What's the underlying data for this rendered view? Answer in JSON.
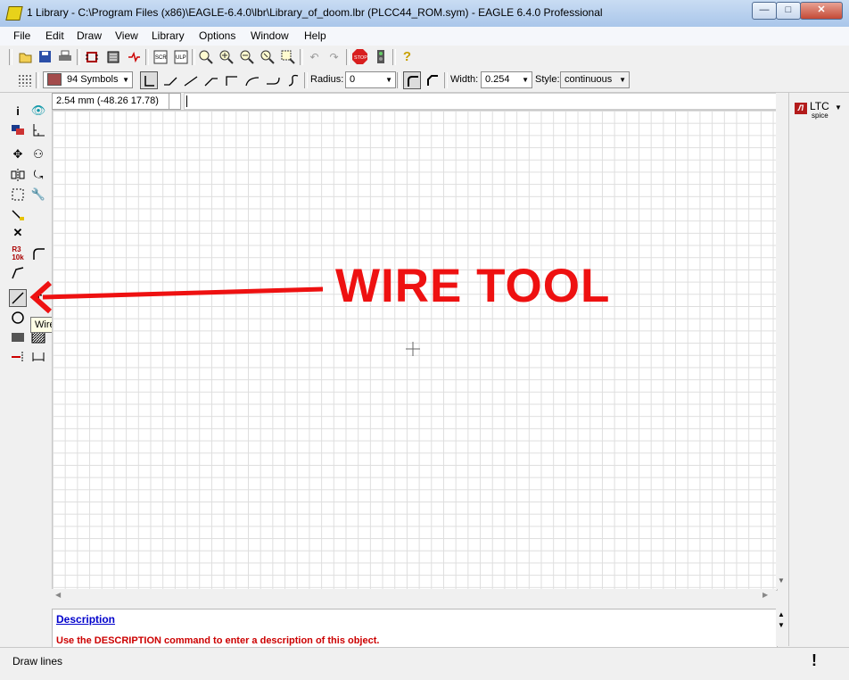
{
  "window": {
    "title": "1 Library - C:\\Program Files (x86)\\EAGLE-6.4.0\\lbr\\Library_of_doom.lbr (PLCC44_ROM.sym) - EAGLE 6.4.0 Professional",
    "minimize": "—",
    "maximize": "□",
    "close": "✕"
  },
  "menu": [
    "File",
    "Edit",
    "Draw",
    "View",
    "Library",
    "Options",
    "Window",
    "Help"
  ],
  "toolbar2": {
    "layer": "94 Symbols",
    "layer_color": "#a34b4b",
    "radius_label": "Radius:",
    "radius_value": "0",
    "width_label": "Width:",
    "width_value": "0.254",
    "style_label": "Style:",
    "style_value": "continuous"
  },
  "coordinates": "2.54 mm (-48.26 17.78)",
  "tooltip": "Wire",
  "annotation": "WIRE TOOL",
  "description": {
    "title": "Description",
    "text": "Use the DESCRIPTION command to enter a description of this object."
  },
  "status": "Draw lines",
  "ltc": {
    "main": "LTC",
    "sub": "spice"
  },
  "colors": {
    "annotation": "#ee1111",
    "description_link": "#0000cc",
    "description_hint": "#cc0000"
  }
}
